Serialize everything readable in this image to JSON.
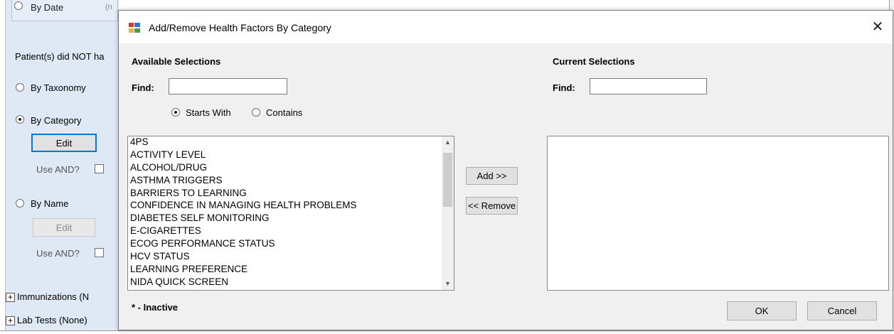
{
  "background": {
    "by_date_label": "By Date",
    "obscured_fragment_1": "(n",
    "not_have_label": "Patient(s) did NOT ha",
    "by_taxonomy_label": "By Taxonomy",
    "by_category_label": "By Category",
    "edit_label": "Edit",
    "use_and_label": "Use AND?",
    "by_name_label": "By Name",
    "edit2_label": "Edit",
    "use_and2_label": "Use AND?",
    "immunizations_label": "Immunizations (N",
    "lab_tests_label": "Lab Tests (None)"
  },
  "dialog": {
    "title": "Add/Remove Health Factors By Category",
    "available": {
      "header": "Available Selections",
      "find_label": "Find:",
      "find_value": "",
      "starts_with_label": "Starts With",
      "contains_label": "Contains",
      "items": [
        "4PS",
        "ACTIVITY LEVEL",
        "ALCOHOL/DRUG",
        "ASTHMA TRIGGERS",
        "BARRIERS TO LEARNING",
        "CONFIDENCE IN MANAGING HEALTH PROBLEMS",
        "DIABETES SELF MONITORING",
        "E-CIGARETTES",
        "ECOG PERFORMANCE STATUS",
        "HCV STATUS",
        "LEARNING PREFERENCE",
        "NIDA QUICK SCREEN"
      ]
    },
    "current": {
      "header": "Current Selections",
      "find_label": "Find:",
      "find_value": ""
    },
    "add_label": "Add >>",
    "remove_label": "<< Remove",
    "inactive_note": "* - Inactive",
    "ok_label": "OK",
    "cancel_label": "Cancel"
  }
}
